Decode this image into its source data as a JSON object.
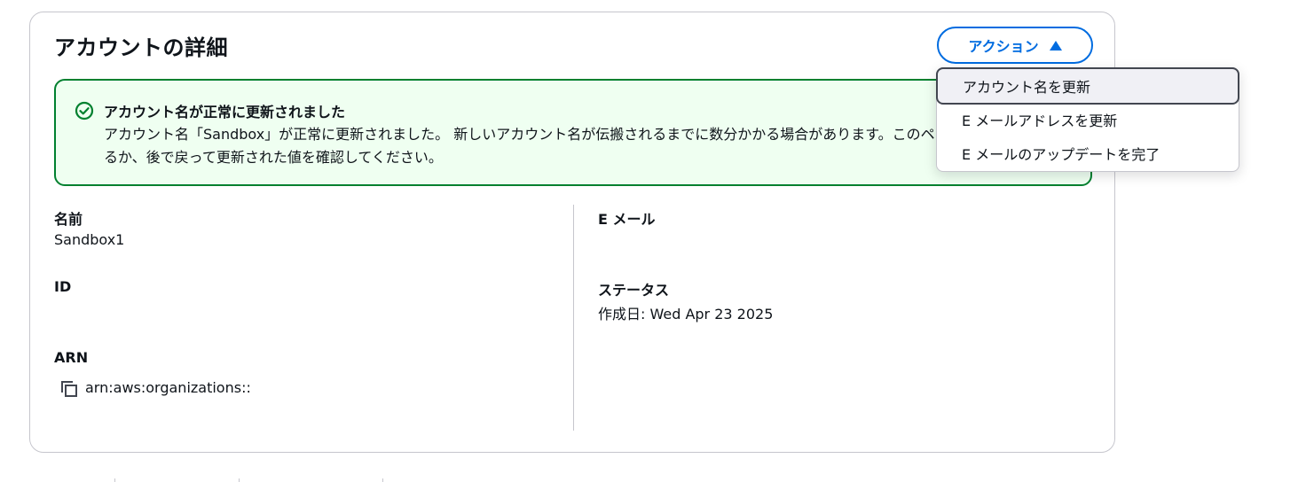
{
  "card": {
    "title": "アカウントの詳細",
    "actions_label": "アクション"
  },
  "flash": {
    "status": "success",
    "title": "アカウント名が正常に更新されました",
    "message": "アカウント名「Sandbox」が正常に更新されました。 新しいアカウント名が伝搬されるまでに数分かかる場合があります。このページを更新するか、後で戻って更新された値を確認してください。",
    "color": "#00802f",
    "background": "#effff1"
  },
  "details": {
    "name_label": "名前",
    "name_value": "Sandbox1",
    "id_label": "ID",
    "id_value": "",
    "arn_label": "ARN",
    "arn_value": "arn:aws:organizations::",
    "email_label": "E メール",
    "email_value": "",
    "status_label": "ステータス",
    "status_value": "作成日: Wed Apr 23 2025"
  },
  "dropdown": {
    "items": [
      {
        "label": "アカウント名を更新",
        "highlighted": true
      },
      {
        "label": "E メールアドレスを更新",
        "highlighted": false
      },
      {
        "label": "E メールのアップデートを完了",
        "highlighted": false
      }
    ]
  },
  "colors": {
    "accent": "#006ce0",
    "border": "#c6c6cd",
    "text": "#0f141a"
  }
}
